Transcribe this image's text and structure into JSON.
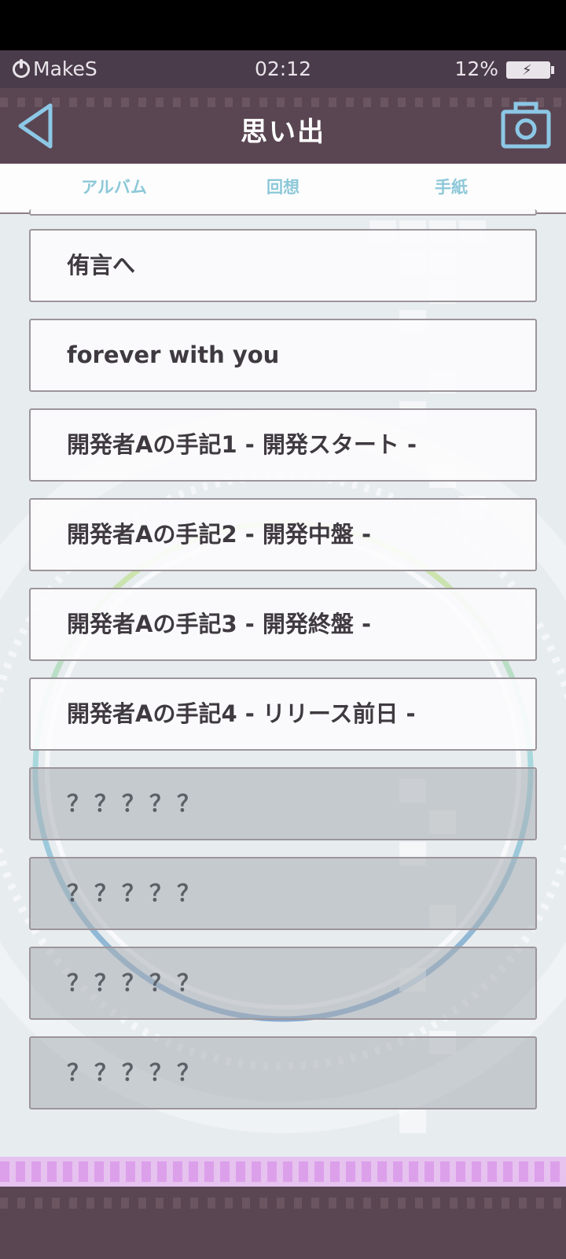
{
  "status_bar": {
    "brand": "MakeS",
    "time": "02:12",
    "battery": "12%"
  },
  "header": {
    "title": "思い出"
  },
  "tabs": [
    {
      "label": "アルバム",
      "active": false
    },
    {
      "label": "回想",
      "active": false
    },
    {
      "label": "手紙",
      "active": true
    }
  ],
  "letters": [
    {
      "title": "侑言へ",
      "locked": false
    },
    {
      "title": "forever with you",
      "locked": false
    },
    {
      "title": "開発者Aの手記1 - 開発スタート -",
      "locked": false
    },
    {
      "title": "開発者Aの手記2 - 開発中盤 -",
      "locked": false
    },
    {
      "title": "開発者Aの手記3 - 開発終盤 -",
      "locked": false
    },
    {
      "title": "開発者Aの手記4 - リリース前日 -",
      "locked": false
    },
    {
      "title": "？？？？？",
      "locked": true
    },
    {
      "title": "？？？？？",
      "locked": true
    },
    {
      "title": "？？？？？",
      "locked": true
    },
    {
      "title": "？？？？？",
      "locked": true
    }
  ],
  "icons": {
    "back": "back-arrow-icon",
    "camera": "camera-icon",
    "power": "power-icon",
    "battery": "battery-charging-icon"
  },
  "colors": {
    "accent": "#86d3d6",
    "header": "#5a4652",
    "tab_text": "#8cc8d8"
  }
}
